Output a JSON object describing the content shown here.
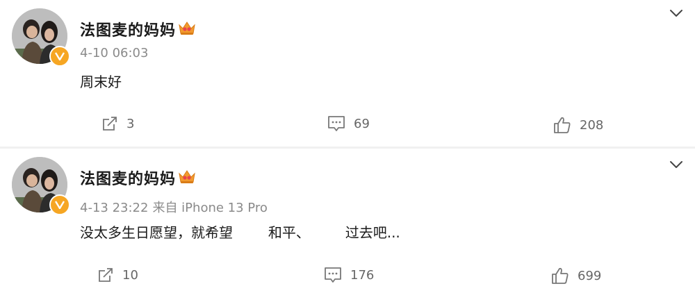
{
  "posts": [
    {
      "username": "法图麦的妈妈",
      "timestamp": "4-10 06:03",
      "source": "",
      "content": "周末好",
      "repost_count": "3",
      "comment_count": "69",
      "like_count": "208"
    },
    {
      "username": "法图麦的妈妈",
      "timestamp": "4-13 23:22",
      "source": "来自 iPhone 13 Pro",
      "content": "没太多生日愿望，就希望        和平、        过去吧...",
      "repost_count": "10",
      "comment_count": "176",
      "like_count": "699"
    }
  ],
  "icons": {
    "verified": "verified-badge-icon",
    "crown": "vip-crown-icon",
    "more": "chevron-down-icon",
    "repost": "repost-icon",
    "comment": "comment-icon",
    "like": "thumbs-up-icon"
  },
  "colors": {
    "verified_badge": "#f6a623",
    "crown": "#f29a2e",
    "meta_text": "#8a8a8a",
    "action_icon": "#777777"
  }
}
